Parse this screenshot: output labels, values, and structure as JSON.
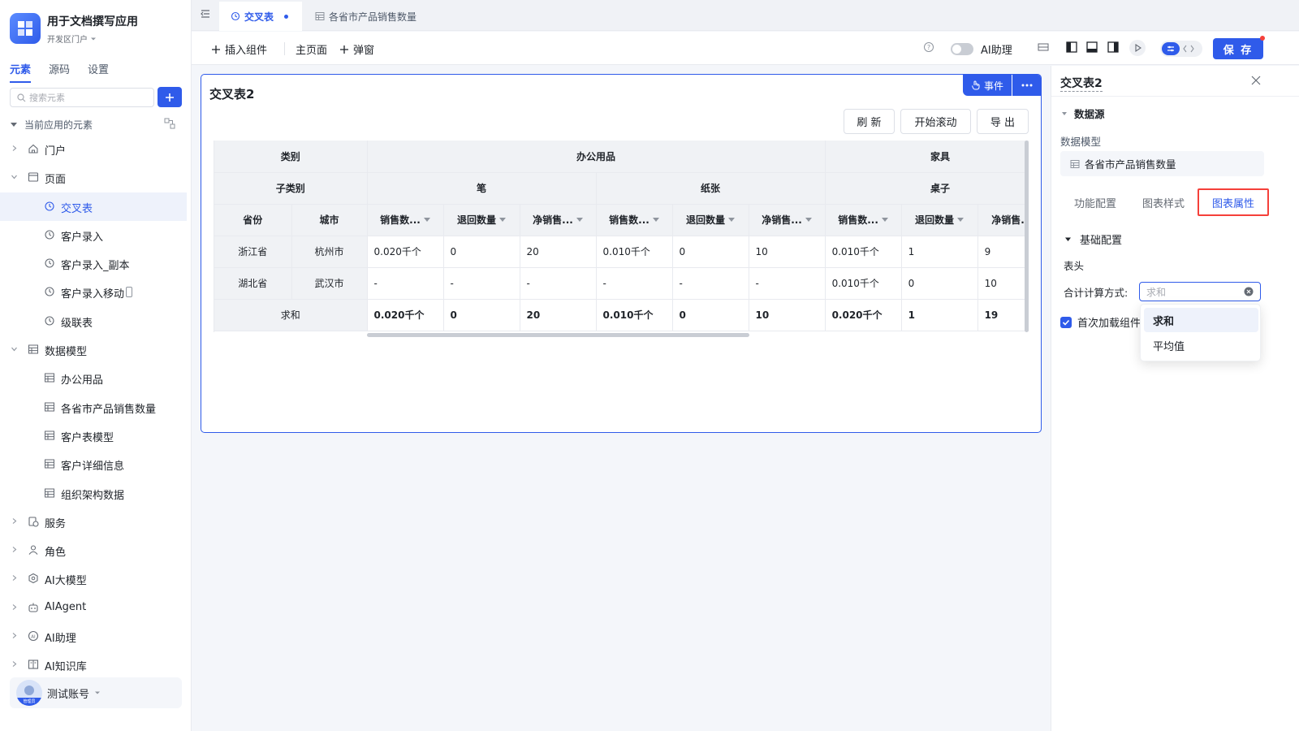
{
  "app": {
    "title": "用于文档撰写应用",
    "subtitle": "开发区门户"
  },
  "sidebar": {
    "tabs": [
      "元素",
      "源码",
      "设置"
    ],
    "active_tab": "元素",
    "search_placeholder": "搜索元素",
    "section_label": "当前应用的元素",
    "tree": [
      {
        "label": "门户",
        "level": 0,
        "expanded": false,
        "icon": "home-icon"
      },
      {
        "label": "页面",
        "level": 0,
        "expanded": true,
        "icon": "page-icon"
      },
      {
        "label": "交叉表",
        "level": 1,
        "selected": true,
        "icon": "page-item-icon"
      },
      {
        "label": "客户录入",
        "level": 1,
        "icon": "page-item-icon"
      },
      {
        "label": "客户录入_副本",
        "level": 1,
        "icon": "page-item-icon"
      },
      {
        "label": "客户录入移动",
        "level": 1,
        "icon": "page-item-icon",
        "mobile": true
      },
      {
        "label": "级联表",
        "level": 1,
        "icon": "page-item-icon"
      },
      {
        "label": "数据模型",
        "level": 0,
        "expanded": true,
        "icon": "table-icon"
      },
      {
        "label": "办公用品",
        "level": 1,
        "icon": "table-icon"
      },
      {
        "label": "各省市产品销售数量",
        "level": 1,
        "icon": "table-icon"
      },
      {
        "label": "客户表模型",
        "level": 1,
        "icon": "table-icon"
      },
      {
        "label": "客户详细信息",
        "level": 1,
        "icon": "table-icon"
      },
      {
        "label": "组织架构数据",
        "level": 1,
        "icon": "table-icon"
      },
      {
        "label": "服务",
        "level": 0,
        "expanded": false,
        "icon": "service-icon"
      },
      {
        "label": "角色",
        "level": 0,
        "expanded": false,
        "icon": "role-icon"
      },
      {
        "label": "AI大模型",
        "level": 0,
        "expanded": false,
        "icon": "ai-model-icon"
      },
      {
        "label": "AIAgent",
        "level": 0,
        "expanded": false,
        "icon": "robot-icon"
      },
      {
        "label": "AI助理",
        "level": 0,
        "expanded": false,
        "icon": "ai-assistant-icon"
      },
      {
        "label": "AI知识库",
        "level": 0,
        "expanded": false,
        "icon": "knowledge-icon"
      }
    ],
    "user": {
      "name": "测试账号",
      "badge": "管理员"
    }
  },
  "tabs": [
    {
      "label": "交叉表",
      "active": true,
      "modified": true
    },
    {
      "label": "各省市产品销售数量",
      "active": false
    }
  ],
  "toolbar": {
    "insert_component": "插入组件",
    "main_page": "主页面",
    "popup": "弹窗",
    "ai_assistant": "AI助理",
    "ai_enabled": false,
    "save": "保 存"
  },
  "widget": {
    "title": "交叉表2",
    "event_button": "事件",
    "buttons": [
      "刷 新",
      "开始滚动",
      "导 出"
    ],
    "pivot": {
      "row_header_labels": [
        "类别",
        "子类别"
      ],
      "row_dims": [
        "省份",
        "城市"
      ],
      "categories": [
        {
          "name": "办公用品",
          "span": 6
        },
        {
          "name": "家具",
          "span": 3
        }
      ],
      "subcategories": [
        "笔",
        "纸张",
        "桌子"
      ],
      "measures": [
        "销售数...",
        "退回数量",
        "净销售...",
        "销售数...",
        "退回数量",
        "净销售...",
        "销售数...",
        "退回数量",
        "净销售..."
      ],
      "rows": [
        {
          "province": "浙江省",
          "city": "杭州市",
          "values": [
            "0.020千个",
            "0",
            "20",
            "0.010千个",
            "0",
            "10",
            "0.010千个",
            "1",
            "9"
          ]
        },
        {
          "province": "湖北省",
          "city": "武汉市",
          "values": [
            "-",
            "-",
            "-",
            "-",
            "-",
            "-",
            "0.010千个",
            "0",
            "10"
          ]
        }
      ],
      "total": {
        "label": "求和",
        "values": [
          "0.020千个",
          "0",
          "20",
          "0.010千个",
          "0",
          "10",
          "0.020千个",
          "1",
          "19"
        ]
      }
    }
  },
  "panel": {
    "title": "交叉表2",
    "datasource_section": "数据源",
    "data_model_label": "数据模型",
    "data_model_value": "各省市产品销售数量",
    "tabs": [
      "功能配置",
      "图表样式",
      "图表属性"
    ],
    "active_tab": "图表属性",
    "basic_config": "基础配置",
    "header_label": "表头",
    "total_calc_label": "合计计算方式:",
    "total_calc_placeholder": "求和",
    "first_load_label": "首次加载组件",
    "first_load_checked": true,
    "dropdown_options": [
      "求和",
      "平均值"
    ],
    "dropdown_selected": "求和"
  }
}
